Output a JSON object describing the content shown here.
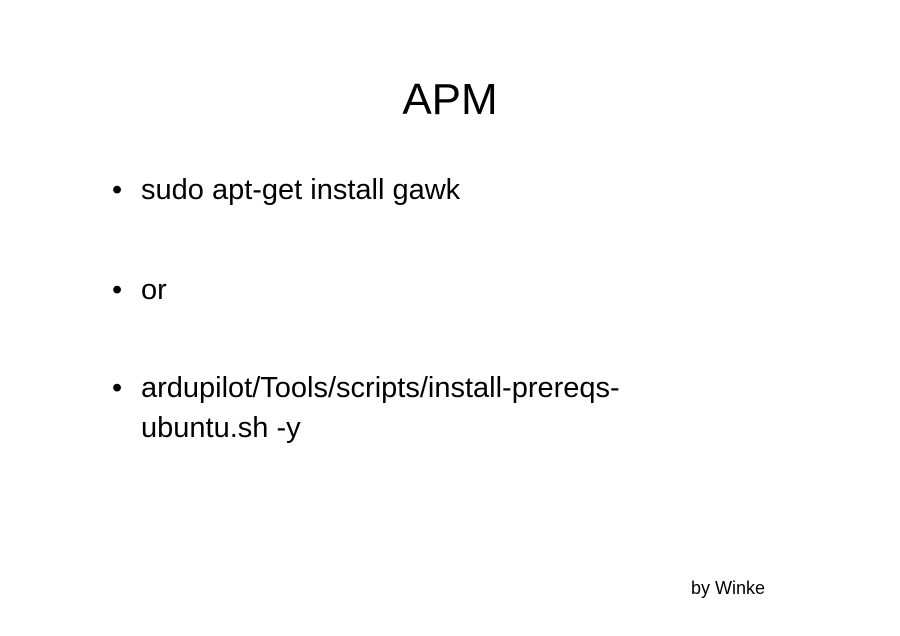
{
  "slide": {
    "title": "APM",
    "bullets": [
      {
        "marker": "•",
        "text": "sudo apt-get install gawk"
      },
      {
        "marker": "•",
        "text": "or"
      },
      {
        "marker": "•",
        "text": "ardupilot/Tools/scripts/install-prereqs-\nubuntu.sh -y"
      }
    ],
    "footer": "by Winke"
  }
}
